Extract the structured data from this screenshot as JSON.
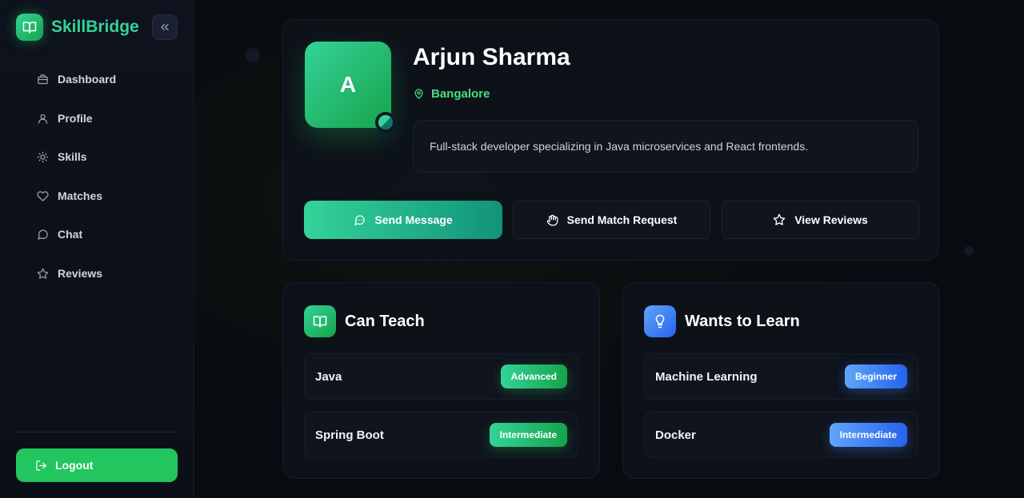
{
  "brand": {
    "name": "SkillBridge",
    "icon": "book-open-icon"
  },
  "sidebar": {
    "collapse_icon": "chevrons-left-icon",
    "items": [
      {
        "label": "Dashboard",
        "icon": "briefcase-icon"
      },
      {
        "label": "Profile",
        "icon": "user-icon"
      },
      {
        "label": "Skills",
        "icon": "lightbulb-icon"
      },
      {
        "label": "Matches",
        "icon": "heart-icon"
      },
      {
        "label": "Chat",
        "icon": "message-circle-icon"
      },
      {
        "label": "Reviews",
        "icon": "star-icon"
      }
    ],
    "logout_label": "Logout"
  },
  "profile": {
    "avatar_initial": "A",
    "name": "Arjun Sharma",
    "location": "Bangalore",
    "bio": "Full-stack developer specializing in Java microservices and React frontends.",
    "actions": {
      "send_message": "Send Message",
      "send_match_request": "Send Match Request",
      "view_reviews": "View Reviews"
    }
  },
  "can_teach": {
    "title": "Can Teach",
    "skills": [
      {
        "name": "Java",
        "level": "Advanced"
      },
      {
        "name": "Spring Boot",
        "level": "Intermediate"
      }
    ]
  },
  "wants_to_learn": {
    "title": "Wants to Learn",
    "skills": [
      {
        "name": "Machine Learning",
        "level": "Beginner"
      },
      {
        "name": "Docker",
        "level": "Intermediate"
      }
    ]
  },
  "colors": {
    "accent_green": "#22c55e",
    "accent_teal": "#34d399",
    "accent_blue": "#3b82f6",
    "background": "#0a0d14"
  }
}
